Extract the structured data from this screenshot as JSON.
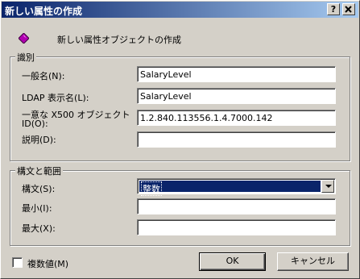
{
  "window": {
    "title": "新しい属性の作成",
    "help_btn": "?",
    "close_btn": "×"
  },
  "header": {
    "text": "新しい属性オブジェクトの作成"
  },
  "identification": {
    "group_title": "識別",
    "common_name": {
      "label": "一般名(N):",
      "value": "SalaryLevel"
    },
    "ldap_name": {
      "label": "LDAP 表示名(L):",
      "value": "SalaryLevel"
    },
    "oid": {
      "label_line1": "一意な X500 オブジェクト",
      "label_line2": "ID(O):",
      "value": "1.2.840.113556.1.4.7000.142"
    },
    "description": {
      "label": "説明(D):",
      "value": ""
    }
  },
  "syntax_range": {
    "group_title": "構文と範囲",
    "syntax": {
      "label": "構文(S):",
      "value": "整数"
    },
    "minimum": {
      "label": "最小(I):",
      "value": ""
    },
    "maximum": {
      "label": "最大(X):",
      "value": ""
    }
  },
  "multivalued": {
    "label": "複数値(M)",
    "checked": false
  },
  "buttons": {
    "ok": "OK",
    "cancel": "キャンセル"
  }
}
